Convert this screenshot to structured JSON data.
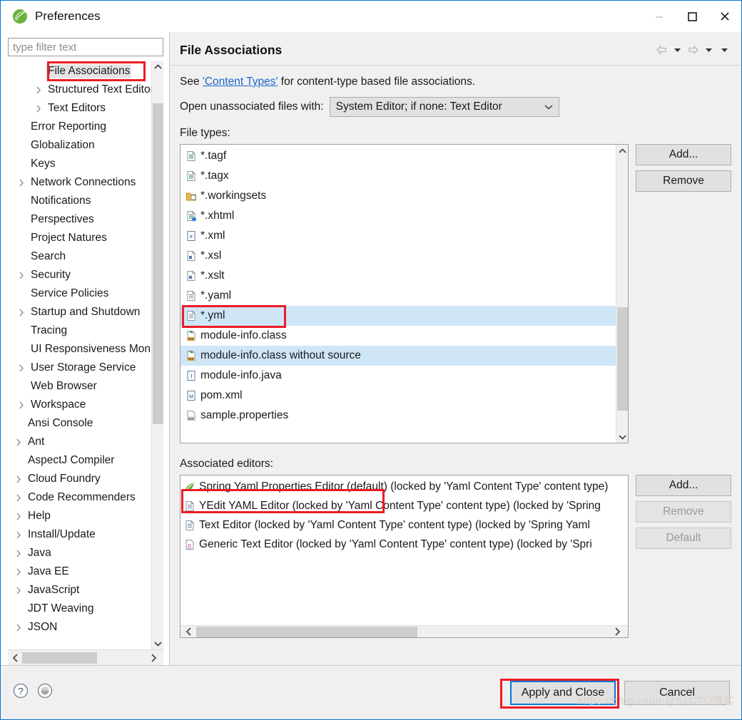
{
  "window": {
    "title": "Preferences",
    "logo_icon": "spring-leaf-icon",
    "controls": {
      "minimize": "minimize-icon",
      "maximize": "maximize-icon",
      "close": "close-icon"
    }
  },
  "sidebar": {
    "filter_placeholder": "type filter text",
    "filter_value": "",
    "items": [
      {
        "label": "File Associations",
        "level": 1,
        "arrow": false,
        "selected": true
      },
      {
        "label": "Structured Text Editors",
        "level": 1,
        "arrow": true,
        "selected": false
      },
      {
        "label": "Text Editors",
        "level": 1,
        "arrow": true,
        "selected": false
      },
      {
        "label": "Error Reporting",
        "level": 0,
        "arrow": false,
        "selected": false
      },
      {
        "label": "Globalization",
        "level": 0,
        "arrow": false,
        "selected": false
      },
      {
        "label": "Keys",
        "level": 0,
        "arrow": false,
        "selected": false
      },
      {
        "label": "Network Connections",
        "level": 0,
        "arrow": true,
        "selected": false
      },
      {
        "label": "Notifications",
        "level": 0,
        "arrow": false,
        "selected": false
      },
      {
        "label": "Perspectives",
        "level": 0,
        "arrow": false,
        "selected": false
      },
      {
        "label": "Project Natures",
        "level": 0,
        "arrow": false,
        "selected": false
      },
      {
        "label": "Search",
        "level": 0,
        "arrow": false,
        "selected": false
      },
      {
        "label": "Security",
        "level": 0,
        "arrow": true,
        "selected": false
      },
      {
        "label": "Service Policies",
        "level": 0,
        "arrow": false,
        "selected": false
      },
      {
        "label": "Startup and Shutdown",
        "level": 0,
        "arrow": true,
        "selected": false
      },
      {
        "label": "Tracing",
        "level": 0,
        "arrow": false,
        "selected": false
      },
      {
        "label": "UI Responsiveness Monitoring",
        "level": 0,
        "arrow": false,
        "selected": false
      },
      {
        "label": "User Storage Service",
        "level": 0,
        "arrow": true,
        "selected": false
      },
      {
        "label": "Web Browser",
        "level": 0,
        "arrow": false,
        "selected": false
      },
      {
        "label": "Workspace",
        "level": 0,
        "arrow": true,
        "selected": false
      },
      {
        "label": "Ansi Console",
        "level": -1,
        "arrow": false,
        "selected": false
      },
      {
        "label": "Ant",
        "level": -1,
        "arrow": true,
        "selected": false
      },
      {
        "label": "AspectJ Compiler",
        "level": -1,
        "arrow": false,
        "selected": false
      },
      {
        "label": "Cloud Foundry",
        "level": -1,
        "arrow": true,
        "selected": false
      },
      {
        "label": "Code Recommenders",
        "level": -1,
        "arrow": true,
        "selected": false
      },
      {
        "label": "Help",
        "level": -1,
        "arrow": true,
        "selected": false
      },
      {
        "label": "Install/Update",
        "level": -1,
        "arrow": true,
        "selected": false
      },
      {
        "label": "Java",
        "level": -1,
        "arrow": true,
        "selected": false
      },
      {
        "label": "Java EE",
        "level": -1,
        "arrow": true,
        "selected": false
      },
      {
        "label": "JavaScript",
        "level": -1,
        "arrow": true,
        "selected": false
      },
      {
        "label": "JDT Weaving",
        "level": -1,
        "arrow": false,
        "selected": false
      },
      {
        "label": "JSON",
        "level": -1,
        "arrow": true,
        "selected": false
      }
    ]
  },
  "page": {
    "title": "File Associations",
    "nav": {
      "back_icon": "arrow-left-icon",
      "back_menu_icon": "caret-down-icon",
      "forward_icon": "arrow-right-icon",
      "forward_menu_icon": "caret-down-icon",
      "menu_icon": "caret-down-icon"
    },
    "see_prefix": "See ",
    "see_link": "'Content Types'",
    "see_suffix": " for content-type based file associations.",
    "open_with_label": "Open unassociated files with:",
    "open_with_value": "System Editor; if none: Text Editor",
    "file_types_label": "File types:",
    "file_types": [
      {
        "label": "*.tagf",
        "icon": "xml-file-icon",
        "highlighted": false
      },
      {
        "label": "*.tagx",
        "icon": "xml-file-icon",
        "highlighted": false
      },
      {
        "label": "*.workingsets",
        "icon": "workingset-icon",
        "highlighted": false
      },
      {
        "label": "*.xhtml",
        "icon": "xhtml-file-icon",
        "highlighted": false
      },
      {
        "label": "*.xml",
        "icon": "xml-doc-icon",
        "highlighted": false
      },
      {
        "label": "*.xsl",
        "icon": "xsl-file-icon",
        "highlighted": false
      },
      {
        "label": "*.xslt",
        "icon": "xsl-file-icon",
        "highlighted": false
      },
      {
        "label": "*.yaml",
        "icon": "text-file-icon",
        "highlighted": false
      },
      {
        "label": "*.yml",
        "icon": "text-file-icon",
        "highlighted": true
      },
      {
        "label": "module-info.class",
        "icon": "class-file-icon",
        "highlighted": false
      },
      {
        "label": "module-info.class without source",
        "icon": "class-file-icon",
        "highlighted": true
      },
      {
        "label": "module-info.java",
        "icon": "java-file-icon",
        "highlighted": false
      },
      {
        "label": "pom.xml",
        "icon": "maven-file-icon",
        "highlighted": false
      },
      {
        "label": "sample.properties",
        "icon": "properties-file-icon",
        "highlighted": false
      }
    ],
    "file_types_buttons": {
      "add": "Add...",
      "remove": "Remove"
    },
    "associated_editors_label": "Associated editors:",
    "associated_editors": [
      {
        "label": "Spring Yaml Properties Editor (default) (locked by 'Yaml Content Type' content type)",
        "icon": "spring-editor-icon"
      },
      {
        "label": "YEdit YAML Editor (locked by 'Yaml Content Type' content type) (locked by 'Spring",
        "icon": "text-file-icon"
      },
      {
        "label": "Text Editor (locked by 'Yaml Content Type' content type) (locked by 'Spring Yaml",
        "icon": "text-file-icon"
      },
      {
        "label": "Generic Text Editor (locked by 'Yaml Content Type' content type) (locked by 'Spri",
        "icon": "generic-editor-icon"
      }
    ],
    "editors_buttons": {
      "add": "Add...",
      "remove": "Remove",
      "default": "Default"
    }
  },
  "footer": {
    "help_icon": "help-icon",
    "restore_icon": "restore-defaults-icon",
    "apply_and_close": "Apply and Close",
    "cancel": "Cancel"
  },
  "watermark": "https://blog.csdn  @51CTO博客",
  "colors": {
    "accent": "#0078d7",
    "annotation": "#ee1c25",
    "selection": "#cfe6f7",
    "link": "#1b66c9",
    "panel": "#f0f0f0"
  }
}
